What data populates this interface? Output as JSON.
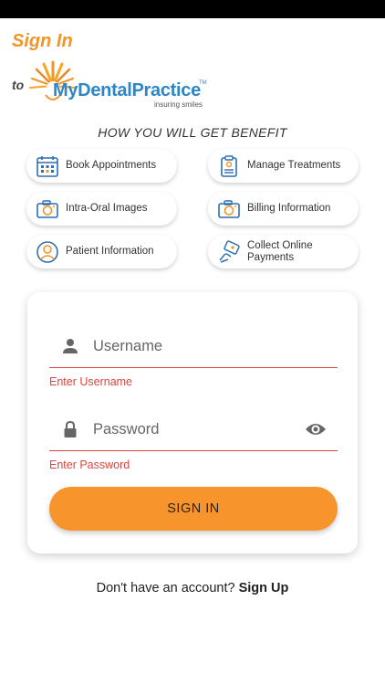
{
  "header": {
    "title": "Sign In",
    "to_label": "to"
  },
  "logo": {
    "name": "MyDentalPractice",
    "tagline": "insuring smiles",
    "tm": "TM"
  },
  "benefits": {
    "heading": "HOW YOU WILL GET BENEFIT",
    "items": [
      {
        "label": "Book Appointments",
        "icon": "calendar-icon"
      },
      {
        "label": "Manage Treatments",
        "icon": "clipboard-icon"
      },
      {
        "label": "Intra-Oral Images",
        "icon": "camera-icon"
      },
      {
        "label": "Billing Information",
        "icon": "camera-icon"
      },
      {
        "label": "Patient Information",
        "icon": "user-circle-icon"
      },
      {
        "label": "Collect Online Payments",
        "icon": "payment-icon"
      }
    ]
  },
  "form": {
    "username_placeholder": "Username",
    "username_error": "Enter Username",
    "password_placeholder": "Password",
    "password_error": "Enter Password",
    "submit_label": "SIGN IN"
  },
  "footer": {
    "prompt": "Don't have an account?",
    "link": "Sign Up"
  },
  "colors": {
    "accent": "#f29527",
    "button": "#f7952c",
    "error": "#d9453f",
    "brand_blue": "#2e86c6"
  }
}
